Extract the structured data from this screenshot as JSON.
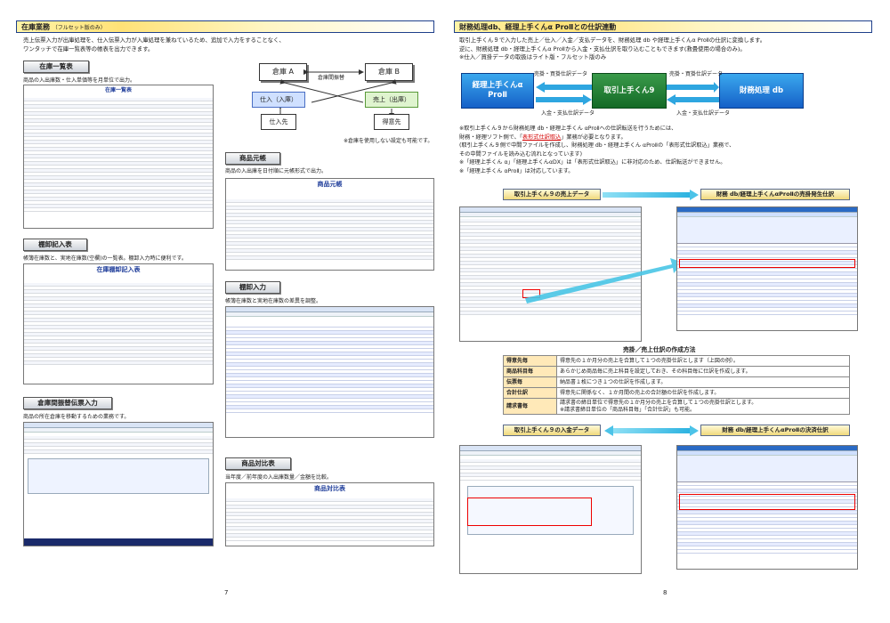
{
  "left": {
    "header_title": "在庫業務",
    "header_sub": "（フルセット版のみ）",
    "intro1": "売上伝票入力が出庫処理を、仕入伝票入力が入庫処理を兼ねているため、追加で入力をすることなく、",
    "intro2": "ワンタッチで在庫一覧表等の帳表を出力できます。",
    "stock_list": {
      "label": "在庫一覧表",
      "desc": "商品の入出庫数・仕入単価等を月単位で出力。",
      "shot_title": "在庫一覧表"
    },
    "diagram": {
      "warehouse_a": "倉庫 A",
      "warehouse_b": "倉庫 B",
      "transfer": "倉庫間振替",
      "purchase_in": "仕入（入庫）",
      "sales_out": "売上（出庫）",
      "supplier": "仕入先",
      "customer": "得意先",
      "note": "※倉庫を使用しない設定も可能です。"
    },
    "ledger": {
      "label": "商品元帳",
      "desc": "商品の入出庫を日付順に元帳形式で出力。",
      "shot_title": "商品元帳"
    },
    "inventory_sheet": {
      "label": "棚卸記入表",
      "desc": "帳簿在庫数と、実地在庫数(空欄)の一覧表。棚卸入力時に便利です。",
      "shot_title": "在庫棚卸記入表"
    },
    "inventory_input": {
      "label": "棚卸入力",
      "desc": "帳簿在庫数と実地在庫数の差異を調整。"
    },
    "transfer_input": {
      "label": "倉庫間振替伝票入力",
      "desc": "商品の所在倉庫を移動するための業務です。"
    },
    "compare": {
      "label": "商品対比表",
      "desc": "当年度／前年度の入出庫数量／金額を比較。",
      "shot_title": "商品対比表"
    },
    "page_number": "7"
  },
  "right": {
    "header_title": "財務処理db、経理上手くんα ProⅡとの仕訳連動",
    "intro1": "取引上手くん９で入力した売上／仕入／入金／支払データを、財務処理 db や経理上手くんα ProⅡの仕訳に変換します。",
    "intro2": "逆に、財務処理 db・経理上手くんα ProⅡから入金・支払仕訳を取り込むこともできます(救畳使用の場合のみ)。",
    "intro3": "※仕入／買掛データの取扱はライト版・フルセット版のみ",
    "flow": {
      "box_left": "経理上手くんα\nProⅡ",
      "box_mid": "取引上手くん9",
      "box_right": "財務処理 db",
      "top_left": "売掛・買掛仕訳データ",
      "bottom_left": "入金・支払仕訳データ",
      "top_right": "売掛・買掛仕訳データ",
      "bottom_right": "入金・支払仕訳データ"
    },
    "notes": [
      "※取引上手くん９から財務処理 db・経理上手くん αProⅡへの仕訳転送を行うためには、",
      "(取引上手くん９側で中間ファイルを作成し、財務処理 db・経理上手くん αProⅡの「表形式仕訳取込」業務で、",
      "その中間ファイルを読み込む流れとなっています)",
      "※「経理上手くん α」「経理上手くんαDX」は「表形式仕訳取込」に非対応のため、仕訳転送ができません。",
      "※「経理上手くん αProⅡ」は対応しています。"
    ],
    "note2_pre": "財務・経理ソフト側で、「",
    "note2_link": "表形式仕訳取込",
    "note2_post": "」業務が必要となります。",
    "sales_caption_left": "取引上手くん９の売上データ",
    "sales_caption_right": "財務 db/経理上手くんαProⅡの売掛発生仕訳",
    "method_title": "売掛／売上仕訳の作成方法",
    "methods": [
      {
        "k": "得意先毎",
        "v": "得意先の１か月分の売上を合算して１つの売掛仕訳とします（上図の例）。"
      },
      {
        "k": "商品科目毎",
        "v": "あらかじめ商品毎に売上科目を設定しておき、その科目毎に仕訳を作成します。"
      },
      {
        "k": "伝票毎",
        "v": "納品書１枚につき１つの仕訳を作成します。"
      },
      {
        "k": "合計仕訳",
        "v": "得意先に関係なく、１か月間の売上の合計額の仕訳を作成します。"
      },
      {
        "k": "請求書毎",
        "v": "請求書の締日単位で得意先の１か月分の売上を合算して１つの売掛仕訳とします。",
        "v2": "※請求書締日単位の「商品科目毎」「合計仕訳」も可能。"
      }
    ],
    "payment_caption_left": "取引上手くん９の入金データ",
    "payment_caption_right": "財務 db/経理上手くんαProⅡの決済仕訳",
    "page_number": "8"
  }
}
